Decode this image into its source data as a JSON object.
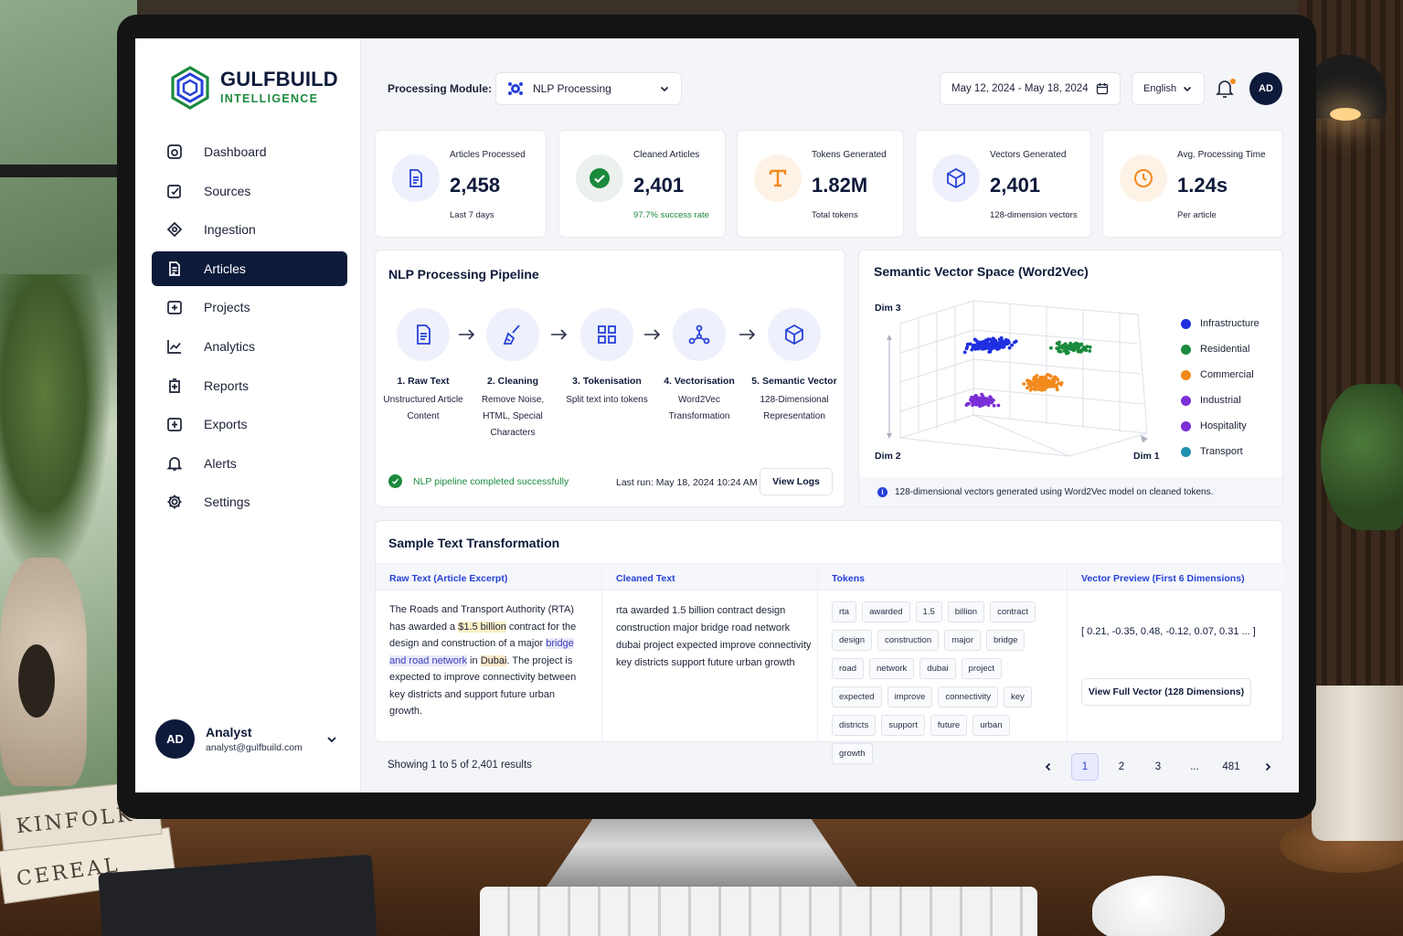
{
  "brand": {
    "title": "GULFBUILD",
    "subtitle": "INTELLIGENCE"
  },
  "sidebar": {
    "items": [
      {
        "label": "Dashboard",
        "icon": "dashboard-icon"
      },
      {
        "label": "Sources",
        "icon": "sources-icon"
      },
      {
        "label": "Ingestion",
        "icon": "ingestion-icon"
      },
      {
        "label": "Articles",
        "icon": "articles-icon",
        "active": true
      },
      {
        "label": "Projects",
        "icon": "projects-icon"
      },
      {
        "label": "Analytics",
        "icon": "analytics-icon"
      },
      {
        "label": "Reports",
        "icon": "reports-icon"
      },
      {
        "label": "Exports",
        "icon": "exports-icon"
      },
      {
        "label": "Alerts",
        "icon": "bell-icon"
      },
      {
        "label": "Settings",
        "icon": "gear-icon"
      }
    ],
    "user": {
      "initials": "AD",
      "name": "Analyst",
      "email": "analyst@gulfbuild.com"
    }
  },
  "header": {
    "module_label": "Processing Module:",
    "module_value": "NLP Processing",
    "date_range": "May 12, 2024 - May 18, 2024",
    "language": "English",
    "avatar_initials": "AD"
  },
  "stats": [
    {
      "label": "Articles Processed",
      "value": "2,458",
      "sub": "Last 7 days",
      "icon": "document-icon",
      "color": "#2741d8"
    },
    {
      "label": "Cleaned Articles",
      "value": "2,401",
      "sub": "97.7% success rate",
      "icon": "check-circle-icon",
      "color": "#1b8a3d"
    },
    {
      "label": "Tokens Generated",
      "value": "1.82M",
      "sub": "Total tokens",
      "icon": "text-t-icon",
      "color": "#f28a1d"
    },
    {
      "label": "Vectors Generated",
      "value": "2,401",
      "sub": "128-dimension vectors",
      "icon": "cube-icon",
      "color": "#2741d8"
    },
    {
      "label": "Avg. Processing Time",
      "value": "1.24s",
      "sub": "Per article",
      "icon": "clock-icon",
      "color": "#f28a1d"
    }
  ],
  "pipeline": {
    "title": "NLP Processing Pipeline",
    "steps": [
      {
        "name": "1. Raw Text",
        "desc": "Unstructured Article Content",
        "icon": "document-icon"
      },
      {
        "name": "2. Cleaning",
        "desc": "Remove Noise, HTML, Special Characters",
        "icon": "broom-icon"
      },
      {
        "name": "3. Tokenisation",
        "desc": "Split text into tokens",
        "icon": "grid-icon"
      },
      {
        "name": "4. Vectorisation",
        "desc": "Word2Vec Transformation",
        "icon": "network-icon"
      },
      {
        "name": "5. Semantic Vector",
        "desc": "128-Dimensional Representation",
        "icon": "cube-icon"
      }
    ],
    "status": "NLP pipeline completed successfully",
    "last_run": "Last run: May 18, 2024 10:24 AM",
    "view_logs": "View Logs"
  },
  "vector_space": {
    "title": "Semantic Vector Space (Word2Vec)",
    "axes": {
      "dim1": "Dim 1",
      "dim2": "Dim 2",
      "dim3": "Dim 3"
    },
    "note": "128-dimensional vectors generated using Word2Vec model on cleaned tokens.",
    "legend": [
      {
        "name": "Infrastructure",
        "color": "#1f2fe0"
      },
      {
        "name": "Residential",
        "color": "#1b8a3d"
      },
      {
        "name": "Commercial",
        "color": "#f28a1d"
      },
      {
        "name": "Industrial",
        "color": "#7b2fd6"
      },
      {
        "name": "Hospitality",
        "color": "#7b2fd6"
      },
      {
        "name": "Transport",
        "color": "#1f8fb0"
      }
    ]
  },
  "chart_data": {
    "type": "scatter",
    "title": "Semantic Vector Space (Word2Vec)",
    "xlabel": "Dim 1",
    "ylabel": "Dim 2",
    "zlabel": "Dim 3",
    "series": [
      {
        "name": "Infrastructure",
        "color": "#1f2fe0",
        "center": [
          0.38,
          0.72
        ],
        "spread": [
          0.13,
          0.06
        ],
        "count": 140
      },
      {
        "name": "Residential",
        "color": "#1b8a3d",
        "center": [
          0.72,
          0.7
        ],
        "spread": [
          0.1,
          0.05
        ],
        "count": 90
      },
      {
        "name": "Commercial",
        "color": "#f28a1d",
        "center": [
          0.6,
          0.45
        ],
        "spread": [
          0.1,
          0.07
        ],
        "count": 140
      },
      {
        "name": "Industrial",
        "color": "#7b2fd6",
        "center": [
          0.34,
          0.32
        ],
        "spread": [
          0.08,
          0.06
        ],
        "count": 90
      }
    ],
    "legend_position": "right"
  },
  "sample": {
    "title": "Sample Text Transformation",
    "columns": [
      "Raw Text (Article Excerpt)",
      "Cleaned Text",
      "Tokens",
      "Vector Preview (First 6 Dimensions)"
    ],
    "raw_parts": [
      {
        "t": "The Roads and Transport Authority (RTA) has awarded a ",
        "c": ""
      },
      {
        "t": "$1.5 billion",
        "c": "hl-money"
      },
      {
        "t": " contract for the design and construction of a major ",
        "c": ""
      },
      {
        "t": "bridge and road network",
        "c": "hl-blue"
      },
      {
        "t": " in ",
        "c": ""
      },
      {
        "t": "Dubai",
        "c": "hl-place"
      },
      {
        "t": ". The project is expected to improve connectivity between key districts and support future urban growth.",
        "c": ""
      }
    ],
    "cleaned": "rta awarded 1.5 billion contract design construction major bridge road network dubai project expected improve connectivity key districts support future urban growth",
    "tokens": [
      "rta",
      "awarded",
      "1.5",
      "billion",
      "contract",
      "design",
      "construction",
      "major",
      "bridge",
      "road",
      "network",
      "dubai",
      "project",
      "expected",
      "improve",
      "connectivity",
      "key",
      "districts",
      "support",
      "future",
      "urban",
      "growth"
    ],
    "vector_preview": "[ 0.21, -0.35, 0.48, -0.12, 0.07, 0.31 ... ]",
    "view_full_vector": "View Full Vector (128 Dimensions)"
  },
  "pagination": {
    "results_text": "Showing 1 to 5 of 2,401 results",
    "pages": [
      "1",
      "2",
      "3",
      "...",
      "481"
    ],
    "current": "1"
  },
  "scene": {
    "book_1": "KINFOLK",
    "book_2": "CEREAL"
  }
}
